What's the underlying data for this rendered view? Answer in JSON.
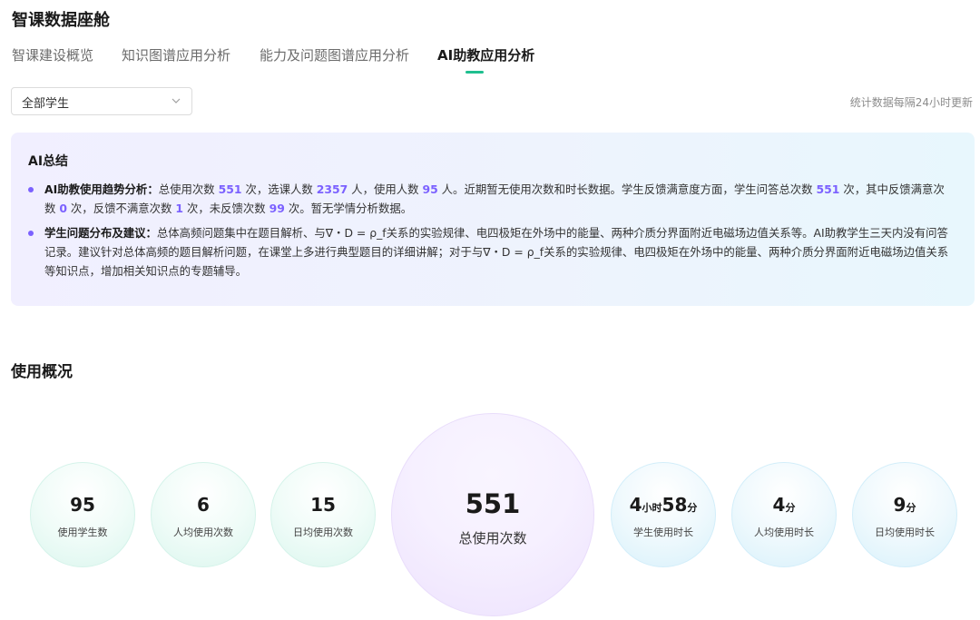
{
  "app": {
    "title": "智课数据座舱"
  },
  "tabs": [
    {
      "label": "智课建设概览"
    },
    {
      "label": "知识图谱应用分析"
    },
    {
      "label": "能力及问题图谱应用分析"
    },
    {
      "label": "AI助教应用分析"
    }
  ],
  "filter": {
    "selected": "全部学生"
  },
  "update_note": "统计数据每隔24小时更新",
  "summary": {
    "title": "AI总结",
    "item1": {
      "heading": "AI助教使用趋势分析：",
      "t1": "总使用次数 ",
      "v1": "551",
      "t2": " 次，选课人数 ",
      "v2": "2357",
      "t3": " 人，使用人数 ",
      "v3": "95",
      "t4": " 人。近期暂无使用次数和时长数据。学生反馈满意度方面，学生问答总次数 ",
      "v4": "551",
      "t5": " 次，其中反馈满意次数 ",
      "v5": "0",
      "t6": " 次，反馈不满意次数 ",
      "v6": "1",
      "t7": " 次，未反馈次数 ",
      "v7": "99",
      "t8": " 次。暂无学情分析数据。"
    },
    "item2": {
      "heading": "学生问题分布及建议：",
      "text": "总体高频问题集中在题目解析、与∇・D = ρ_f关系的实验规律、电四极矩在外场中的能量、两种介质分界面附近电磁场边值关系等。AI助教学生三天内没有问答记录。建议针对总体高频的题目解析问题，在课堂上多进行典型题目的详细讲解；对于与∇・D = ρ_f关系的实验规律、电四极矩在外场中的能量、两种介质分界面附近电磁场边值关系等知识点，增加相关知识点的专题辅导。"
    }
  },
  "section": {
    "title": "使用概况"
  },
  "stats": {
    "students": {
      "value": "95",
      "label": "使用学生数"
    },
    "avg_uses": {
      "value": "6",
      "label": "人均使用次数"
    },
    "daily_uses": {
      "value": "15",
      "label": "日均使用次数"
    },
    "total_uses": {
      "value": "551",
      "label": "总使用次数"
    },
    "student_time": {
      "hours": "4",
      "hours_unit": "小时",
      "minutes": "58",
      "minutes_unit": "分",
      "label": "学生使用时长"
    },
    "avg_time": {
      "value": "4",
      "unit": "分",
      "label": "人均使用时长"
    },
    "daily_time": {
      "value": "9",
      "unit": "分",
      "label": "日均使用时长"
    }
  },
  "colors": {
    "accent": "#1fbf8f",
    "highlight": "#7b61ff"
  },
  "icons": {
    "select_arrow": "chevron-down-icon"
  }
}
